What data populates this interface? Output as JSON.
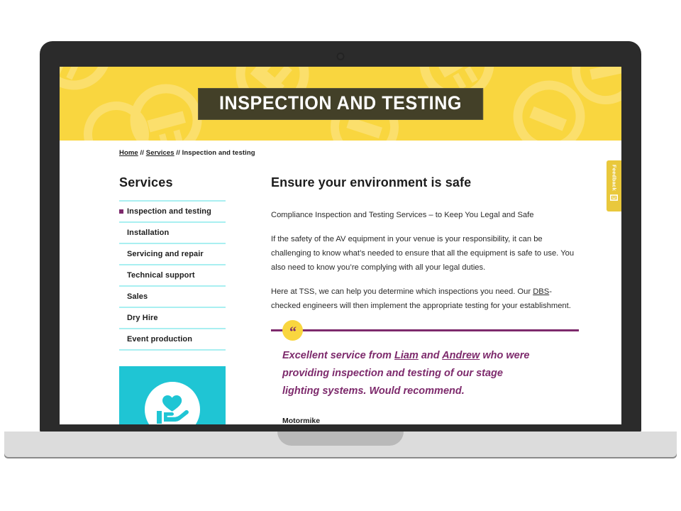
{
  "site": {
    "header_title": "INSPECTION AND TESTING",
    "header_bg": "#f9d63f",
    "header_title_bg": "#434028",
    "accent_purple": "#7d2a6c",
    "accent_teal": "#1fc5d4",
    "divider_cyan": "#a9eff1"
  },
  "breadcrumb": {
    "home": "Home",
    "sep1": " // ",
    "services": "Services",
    "sep2": " // ",
    "current": "Inspection and testing"
  },
  "sidebar": {
    "title": "Services",
    "items": [
      {
        "label": "Inspection and testing",
        "active": true
      },
      {
        "label": "Installation",
        "active": false
      },
      {
        "label": "Servicing and repair",
        "active": false
      },
      {
        "label": "Technical support",
        "active": false
      },
      {
        "label": "Sales",
        "active": false
      },
      {
        "label": "Dry Hire",
        "active": false
      },
      {
        "label": "Event production",
        "active": false
      }
    ],
    "promo_icon": "hand-holding-heart-icon"
  },
  "main": {
    "heading": "Ensure your environment is safe",
    "intro": "Compliance Inspection and Testing Services – to Keep You Legal and Safe",
    "para_2": "If the safety of the AV equipment in your venue is your responsibility, it can be challenging to know what’s needed to ensure that all the equipment is safe to use. You also need to know you’re complying with all your legal duties.",
    "para_3_before": " Here at TSS, we can help you determine which inspections you need. Our ",
    "para_3_link": "DBS",
    "para_3_after": "-checked engineers will then implement the appropriate testing for your establishment."
  },
  "testimonial": {
    "quote_mark": "“",
    "text_1": "Excellent service from ",
    "name_1": "Liam",
    "text_2": " and ",
    "name_2": "Andrew",
    "text_3": " who were providing inspection and testing of our stage lighting systems. Would recommend.",
    "author": "Motormike"
  },
  "feedback": {
    "label": "Feedback",
    "icon": "envelope-icon"
  }
}
